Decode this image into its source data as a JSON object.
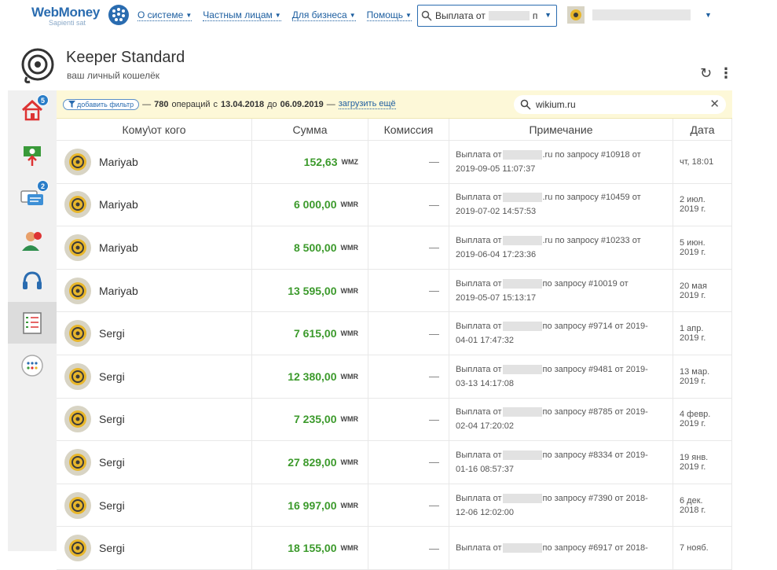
{
  "topnav": {
    "logo_text": "WebMoney",
    "logo_sub": "Sapienti sat",
    "menu": [
      "О системе",
      "Частным лицам",
      "Для бизнеса",
      "Помощь"
    ],
    "search_prefix": "Выплата от",
    "search_suffix": "п"
  },
  "header": {
    "title": "Keeper Standard",
    "subtitle": "ваш личный кошелёк"
  },
  "sidebar": {
    "badges": {
      "home": "5",
      "chat": "2"
    }
  },
  "filter": {
    "button_label": "добавить фильтр",
    "dash": "—",
    "count": "780",
    "ops_word": "операций",
    "from_word": "с",
    "date_from": "13.04.2018",
    "to_word": "до",
    "date_to": "06.09.2019",
    "load_more": "загрузить ещё",
    "search_value": "wikium.ru"
  },
  "table": {
    "headers": [
      "Кому\\от кого",
      "Сумма",
      "Комиссия",
      "Примечание",
      "Дата"
    ],
    "rows": [
      {
        "who": "Mariyab",
        "amount": "152,63",
        "cur": "WMZ",
        "fee": "—",
        "note_a": "Выплата от",
        "note_b": ".ru по запросу #10918 от",
        "note_c": "2019-09-05 11:07:37",
        "date1": "чт, 18:01",
        "date2": ""
      },
      {
        "who": "Mariyab",
        "amount": "6 000,00",
        "cur": "WMR",
        "fee": "—",
        "note_a": "Выплата от",
        "note_b": ".ru по запросу #10459 от",
        "note_c": "2019-07-02 14:57:53",
        "date1": "2 июл.",
        "date2": "2019 г."
      },
      {
        "who": "Mariyab",
        "amount": "8 500,00",
        "cur": "WMR",
        "fee": "—",
        "note_a": "Выплата от",
        "note_b": ".ru по запросу #10233 от",
        "note_c": "2019-06-04 17:23:36",
        "date1": "5 июн.",
        "date2": "2019 г."
      },
      {
        "who": "Mariyab",
        "amount": "13 595,00",
        "cur": "WMR",
        "fee": "—",
        "note_a": "Выплата от",
        "note_b": "по запросу #10019 от",
        "note_c": "2019-05-07 15:13:17",
        "date1": "20 мая",
        "date2": "2019 г."
      },
      {
        "who": "Sergi",
        "amount": "7 615,00",
        "cur": "WMR",
        "fee": "—",
        "note_a": "Выплата от",
        "note_b": "по запросу #9714 от 2019-",
        "note_c": "04-01 17:47:32",
        "date1": "1 апр.",
        "date2": "2019 г."
      },
      {
        "who": "Sergi",
        "amount": "12 380,00",
        "cur": "WMR",
        "fee": "—",
        "note_a": "Выплата от",
        "note_b": "по запросу #9481 от 2019-",
        "note_c": "03-13 14:17:08",
        "date1": "13 мар.",
        "date2": "2019 г."
      },
      {
        "who": "Sergi",
        "amount": "7 235,00",
        "cur": "WMR",
        "fee": "—",
        "note_a": "Выплата от",
        "note_b": "по запросу #8785 от 2019-",
        "note_c": "02-04 17:20:02",
        "date1": "4 февр.",
        "date2": "2019 г."
      },
      {
        "who": "Sergi",
        "amount": "27 829,00",
        "cur": "WMR",
        "fee": "—",
        "note_a": "Выплата от",
        "note_b": "по запросу #8334 от 2019-",
        "note_c": "01-16 08:57:37",
        "date1": "19 янв.",
        "date2": "2019 г."
      },
      {
        "who": "Sergi",
        "amount": "16 997,00",
        "cur": "WMR",
        "fee": "—",
        "note_a": "Выплата от",
        "note_b": "по запросу #7390 от 2018-",
        "note_c": "12-06 12:02:00",
        "date1": "6 дек.",
        "date2": "2018 г."
      },
      {
        "who": "Sergi",
        "amount": "18 155,00",
        "cur": "WMR",
        "fee": "—",
        "note_a": "Выплата от",
        "note_b": "по запросу #6917 от 2018-",
        "note_c": "",
        "date1": "7 нояб.",
        "date2": ""
      }
    ]
  }
}
